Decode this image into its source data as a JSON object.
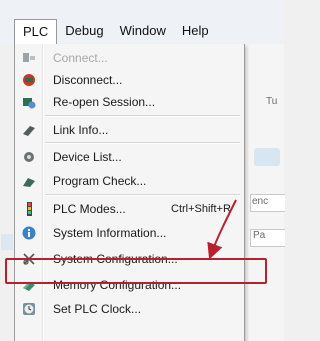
{
  "menubar": {
    "items": [
      {
        "label": "PLC",
        "active": true
      },
      {
        "label": "Debug"
      },
      {
        "label": "Window"
      },
      {
        "label": "Help"
      }
    ]
  },
  "background": {
    "fragments": [
      "Tu",
      "enc",
      "Pa"
    ]
  },
  "menu": {
    "items": [
      {
        "label": "Connect...",
        "icon": "connect-icon",
        "disabled": true
      },
      {
        "label": "Disconnect...",
        "icon": "disconnect-icon"
      },
      {
        "label": "Re-open Session...",
        "icon": "reopen-session-icon"
      },
      {
        "label": "Link Info...",
        "icon": "link-info-icon"
      },
      {
        "label": "Device List...",
        "icon": "device-list-icon"
      },
      {
        "label": "Program Check...",
        "icon": "program-check-icon"
      },
      {
        "label": "PLC Modes...",
        "icon": "plc-modes-icon",
        "shortcut": "Ctrl+Shift+R"
      },
      {
        "label": "System Information...",
        "icon": "system-information-icon"
      },
      {
        "label": "System Configuration...",
        "icon": "system-configuration-icon",
        "highlighted": true
      },
      {
        "label": "Memory Configuration...",
        "icon": "memory-configuration-icon"
      },
      {
        "label": "Set PLC Clock...",
        "icon": "set-plc-clock-icon"
      }
    ]
  },
  "colors": {
    "highlight_border": "#b82030",
    "disabled_text": "#a8a8a8",
    "menu_background": "#f5f5f5"
  }
}
